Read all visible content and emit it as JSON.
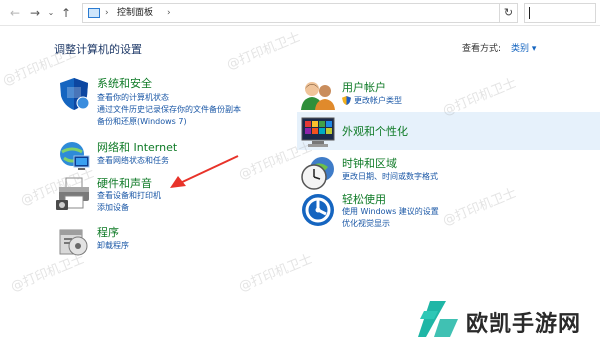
{
  "address_bar": {
    "back_icon": "back-arrow-icon",
    "forward_icon": "forward-arrow-icon",
    "recent_icon": "chevron-down-icon",
    "up_icon": "up-arrow-icon",
    "path": "控制面板",
    "refresh_icon": "refresh-icon"
  },
  "header": {
    "title": "调整计算机的设置",
    "view_by_label": "查看方式:",
    "view_by_value": "类别 ▾"
  },
  "left_categories": [
    {
      "title": "系统和安全",
      "links": [
        "查看你的计算机状态",
        "通过文件历史记录保存你的文件备份副本",
        "备份和还原(Windows 7)"
      ],
      "icon": "shield-icon"
    },
    {
      "title": "网络和 Internet",
      "links": [
        "查看网络状态和任务"
      ],
      "icon": "network-icon"
    },
    {
      "title": "硬件和声音",
      "links": [
        "查看设备和打印机",
        "添加设备"
      ],
      "icon": "printer-icon"
    },
    {
      "title": "程序",
      "links": [
        "卸载程序"
      ],
      "icon": "programs-icon"
    }
  ],
  "right_categories": [
    {
      "title": "用户帐户",
      "links": [
        "更改帐户类型"
      ],
      "icon": "users-icon"
    },
    {
      "title": "外观和个性化",
      "links": [],
      "icon": "appearance-icon"
    },
    {
      "title": "时钟和区域",
      "links": [
        "更改日期、时间或数字格式"
      ],
      "icon": "clock-icon"
    },
    {
      "title": "轻松使用",
      "links": [
        "使用 Windows 建议的设置",
        "优化视觉显示"
      ],
      "icon": "accessibility-icon"
    }
  ],
  "watermark_text": "@打印机卫士",
  "logo": {
    "text": "欧凯手游网",
    "color": "#1fb6a6"
  },
  "colors": {
    "category_title": "#0e7a26",
    "link": "#1a57a6",
    "annotation_arrow": "#e8332a",
    "highlight": "#e6f1fb"
  }
}
